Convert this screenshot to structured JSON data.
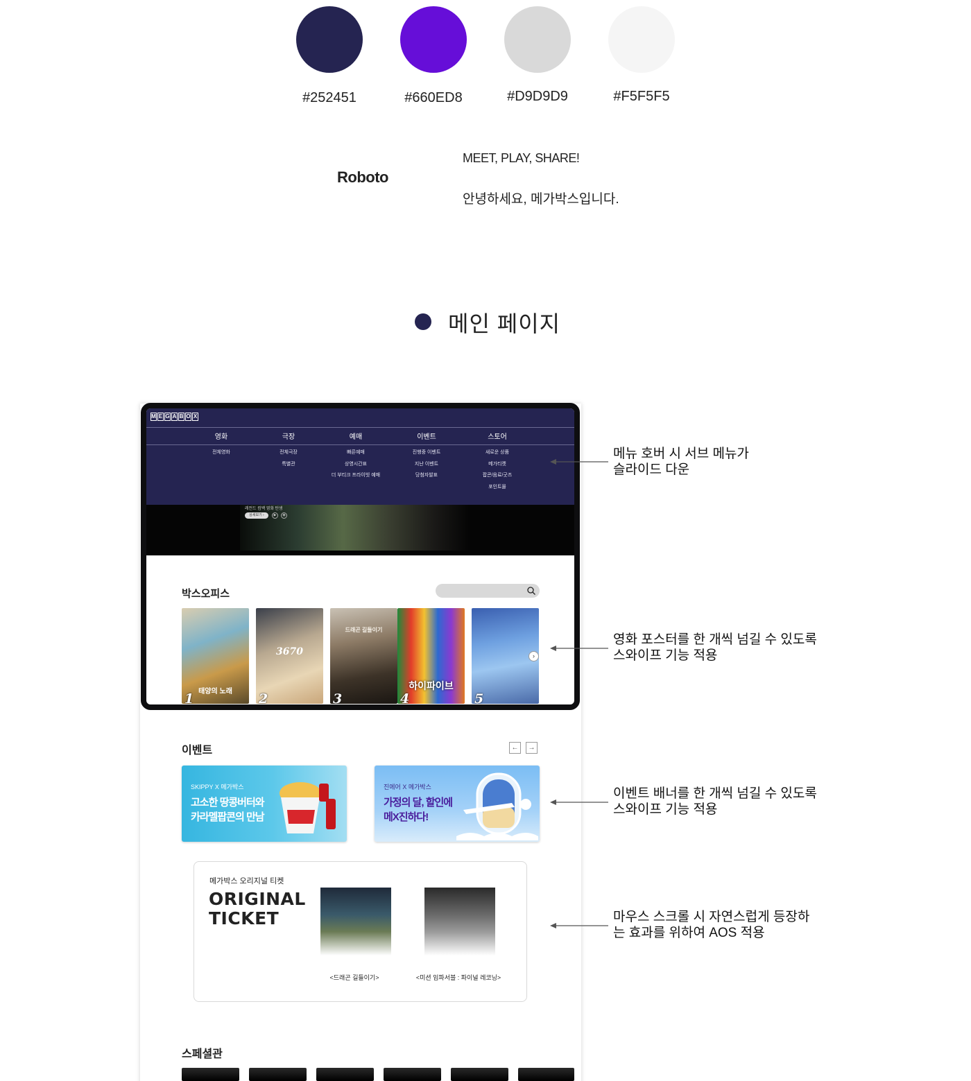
{
  "palette": [
    {
      "hex": "#252451",
      "label": "#252451"
    },
    {
      "hex": "#660ED8",
      "label": "#660ED8"
    },
    {
      "hex": "#D9D9D9",
      "label": "#D9D9D9"
    },
    {
      "hex": "#F5F5F5",
      "label": "#F5F5F5"
    }
  ],
  "typography": {
    "font_name": "Roboto",
    "sample_en": "MEET, PLAY, SHARE!",
    "sample_ko": "안녕하세요, 메가박스입니다."
  },
  "section": {
    "title": "메인 페이지"
  },
  "site": {
    "logo_letters": [
      "M",
      "E",
      "G",
      "A",
      "B",
      "O",
      "X"
    ],
    "menu": [
      {
        "label": "영화",
        "items": [
          "전체영화"
        ]
      },
      {
        "label": "극장",
        "items": [
          "전체극장",
          "특별관"
        ]
      },
      {
        "label": "예매",
        "items": [
          "빠른예매",
          "상영시간표",
          "더 부티크 프라이빗 예매"
        ]
      },
      {
        "label": "이벤트",
        "items": [
          "진행중 이벤트",
          "지난 이벤트",
          "당첨자발표"
        ]
      },
      {
        "label": "스토어",
        "items": [
          "새로운 상품",
          "메가티켓",
          "팝콘/음료/굿즈",
          "포인트몰"
        ]
      }
    ],
    "hero": {
      "caption": "레전드 컴백 영화 탄생",
      "detail_button": "상세보기 ›",
      "play_icon": "play-icon",
      "sound_icon": "sound-icon"
    },
    "box_office": {
      "title": "박스오피스",
      "posters": [
        {
          "rank": "1",
          "text": "태양의 노래"
        },
        {
          "rank": "2",
          "text": "3670"
        },
        {
          "rank": "3",
          "text": "드래곤 길들이기"
        },
        {
          "rank": "4",
          "text": "하이파이브"
        },
        {
          "rank": "5",
          "text": ""
        }
      ]
    },
    "events": {
      "title": "이벤트",
      "prev_arrow": "←",
      "next_arrow": "→",
      "banners": [
        {
          "sub": "SKIPPY X 메가박스",
          "line1": "고소한 땅콩버터와",
          "line2": "카라멜팝콘의 만남"
        },
        {
          "sub": "진에어 X 메가박스",
          "line1": "가정의 달, 할인에",
          "line2": "메X진하다!"
        }
      ]
    },
    "original_ticket": {
      "small": "메가박스 오리지널 티켓",
      "big_line1": "ORIGINAL",
      "big_line2": "TICKET",
      "tickets": [
        {
          "caption": "<드래곤 길들이기>"
        },
        {
          "caption": "<미션 임파서블 : 파이널 레코닝>"
        }
      ]
    },
    "special": {
      "title": "스페셜관"
    }
  },
  "annotations": [
    {
      "line1": "메뉴 호버 시 서브 메뉴가",
      "line2": "슬라이드 다운"
    },
    {
      "line1": "영화 포스터를 한 개씩 넘길 수 있도록",
      "line2": "스와이프 기능 적용"
    },
    {
      "line1": "이벤트 배너를 한 개씩 넘길 수 있도록",
      "line2": "스와이프 기능 적용"
    },
    {
      "line1": "마우스 스크롤 시 자연스럽게 등장하",
      "line2": "는 효과를 위하여 AOS 적용"
    }
  ]
}
